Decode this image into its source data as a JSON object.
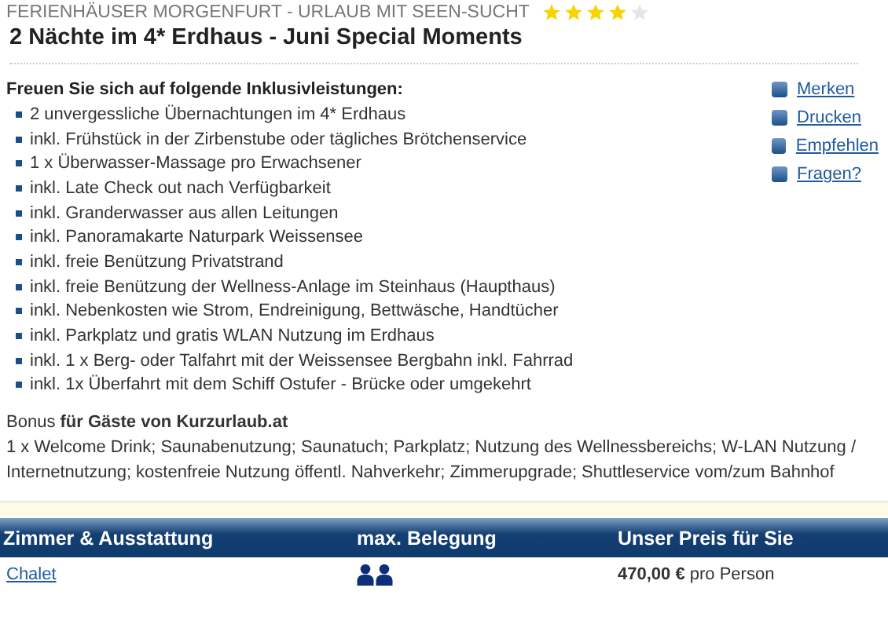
{
  "hotel": {
    "name": "FERIENHÄUSER MORGENFURT - URLAUB MIT SEEN-SUCHT",
    "stars": 4
  },
  "offer_title": "2 Nächte im 4* Erdhaus - Juni Special Moments",
  "inclusions": {
    "heading": "Freuen Sie sich auf folgende Inklusivleistungen:",
    "items": [
      "2 unvergessliche Übernachtungen im 4* Erdhaus",
      "inkl. Frühstück in der Zirbenstube oder tägliches Brötchenservice",
      "1 x Überwasser-Massage pro Erwachsener",
      "inkl. Late Check out nach Verfügbarkeit",
      "inkl. Granderwasser aus allen Leitungen",
      "inkl. Panoramakarte Naturpark Weissensee",
      "inkl. freie Benützung Privatstrand",
      "inkl. freie Benützung der Wellness-Anlage im Steinhaus (Haupthaus)",
      "inkl. Nebenkosten wie Strom, Endreinigung, Bettwäsche, Handtücher",
      "inkl. Parkplatz und gratis WLAN Nutzung im Erdhaus",
      "inkl. 1 x Berg- oder Talfahrt mit der Weissensee Bergbahn inkl. Fahrrad",
      "inkl. 1x Überfahrt mit dem Schiff Ostufer - Brücke oder umgekehrt"
    ]
  },
  "actions": [
    "Merken",
    "Drucken",
    "Empfehlen",
    "Fragen?"
  ],
  "bonus": {
    "heading": "Bonus **für Gäste von Kurzurlaub.at**",
    "text": "1 x Welcome Drink; Saunabenutzung; Saunatuch; Parkplatz; Nutzung des Wellnessbereichs; W-LAN Nutzung / Internetnutzung; kostenfreie Nutzung öffentl. Nahverkehr; Zimmerupgrade; Shuttleservice vom/zum Bahnhof"
  },
  "table": {
    "columns": [
      "Zimmer & Ausstattung",
      "max. Belegung",
      "Unser Preis für Sie"
    ],
    "rows": [
      {
        "room": "Chalet",
        "occupancy": [
          {
            "kind": "person"
          },
          {
            "kind": "person"
          }
        ],
        "price": "**470,00 €** pro Person"
      }
    ]
  }
}
